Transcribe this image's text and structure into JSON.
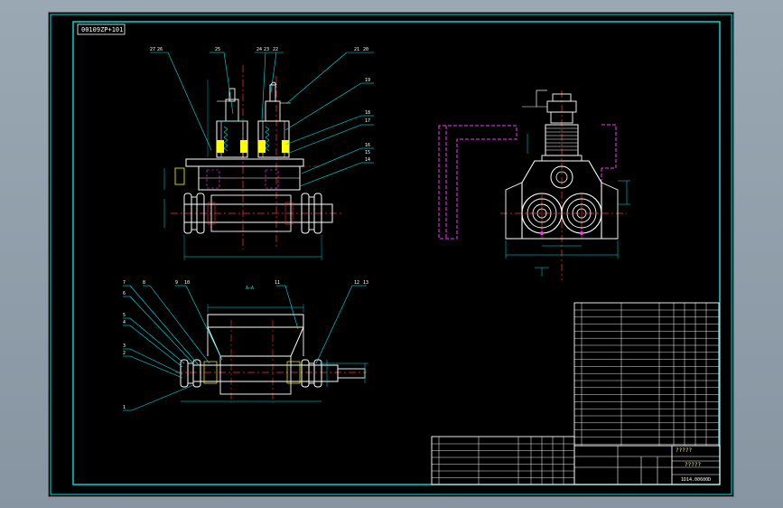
{
  "drawing": {
    "stamp": "00109ZP+101",
    "section_label": "A—A",
    "title_block": {
      "name": "?????",
      "drawing_number": "1D14.00600D",
      "title_text": "?????"
    },
    "balloons_front": [
      "27",
      "26",
      "25",
      "24",
      "23",
      "22",
      "21",
      "20",
      "19",
      "18",
      "17",
      "16",
      "15",
      "14"
    ],
    "balloons_plan": [
      "7",
      "8",
      "9",
      "10",
      "11",
      "12",
      "13",
      "6",
      "5",
      "4",
      "3",
      "2",
      "1"
    ],
    "colors": {
      "background": "#000000",
      "border": "#00e5e5",
      "outline": "#ffffff",
      "hidden": "#ff33ff",
      "center": "#ff3333",
      "dimension": "#00e5e5",
      "spring": "#ffff00",
      "leader": "#00e5e5"
    }
  }
}
